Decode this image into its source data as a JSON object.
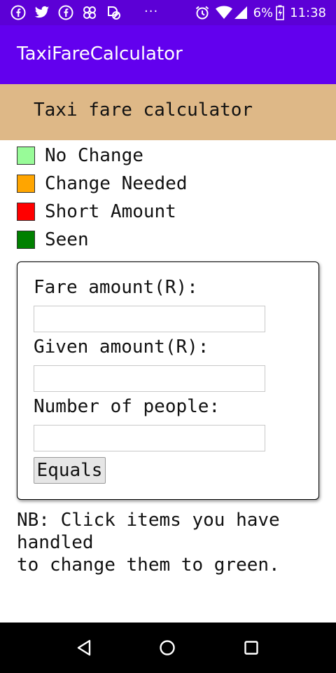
{
  "status_bar": {
    "battery": "6%",
    "time": "11:38",
    "overflow": "···",
    "notification_icons": [
      "facebook-icon",
      "twitter-icon",
      "facebook-icon",
      "pinwheel-icon",
      "no-disturb-icon"
    ]
  },
  "app_bar": {
    "title": "TaxiFareCalculator",
    "color": "#6200ee"
  },
  "header": {
    "text": "Taxi fare calculator",
    "color": "#deb887"
  },
  "legend": [
    {
      "label": "No Change",
      "color": "#98fb98"
    },
    {
      "label": "Change Needed",
      "color": "#ffa500"
    },
    {
      "label": "Short Amount",
      "color": "#ff0000"
    },
    {
      "label": "Seen",
      "color": "#008000"
    }
  ],
  "form": {
    "fare_label": "Fare amount(R):",
    "fare_value": "",
    "given_label": "Given amount(R):",
    "given_value": "",
    "people_label": "Number of people:",
    "people_value": "",
    "equals_label": "Equals"
  },
  "note": "NB: Click items you have handled\nto change them to green.",
  "nav_bar": {
    "icons": [
      "back-icon",
      "home-icon",
      "recents-icon"
    ]
  }
}
